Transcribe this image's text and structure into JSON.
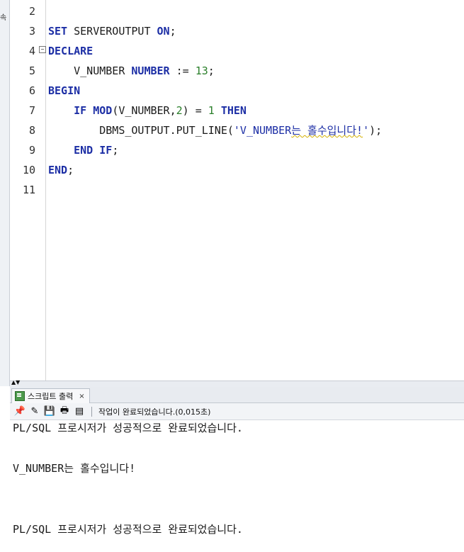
{
  "left_strip": {
    "label": "속"
  },
  "editor": {
    "line_numbers": [
      "2",
      "3",
      "4",
      "5",
      "6",
      "7",
      "8",
      "9",
      "10",
      "11"
    ],
    "lines": [
      {
        "tokens": []
      },
      {
        "tokens": [
          {
            "t": "SET",
            "c": "kw"
          },
          {
            "t": " SERVEROUTPUT ",
            "c": ""
          },
          {
            "t": "ON",
            "c": "kw"
          },
          {
            "t": ";",
            "c": ""
          }
        ]
      },
      {
        "tokens": [
          {
            "t": "DECLARE",
            "c": "kw"
          }
        ]
      },
      {
        "tokens": [
          {
            "t": "    V_NUMBER ",
            "c": ""
          },
          {
            "t": "NUMBER",
            "c": "kw"
          },
          {
            "t": " := ",
            "c": ""
          },
          {
            "t": "13",
            "c": "num"
          },
          {
            "t": ";",
            "c": ""
          }
        ]
      },
      {
        "tokens": [
          {
            "t": "BEGIN",
            "c": "kw"
          }
        ]
      },
      {
        "tokens": [
          {
            "t": "    ",
            "c": ""
          },
          {
            "t": "IF",
            "c": "kw"
          },
          {
            "t": " ",
            "c": ""
          },
          {
            "t": "MOD",
            "c": "kw"
          },
          {
            "t": "(V_NUMBER,",
            "c": ""
          },
          {
            "t": "2",
            "c": "num"
          },
          {
            "t": ") = ",
            "c": ""
          },
          {
            "t": "1",
            "c": "num"
          },
          {
            "t": " ",
            "c": ""
          },
          {
            "t": "THEN",
            "c": "kw"
          }
        ]
      },
      {
        "tokens": [
          {
            "t": "        DBMS_OUTPUT.PUT_LINE(",
            "c": ""
          },
          {
            "t": "'V_NUMBER",
            "c": "str"
          },
          {
            "t": "는 홀수입니다!",
            "c": "str squig"
          },
          {
            "t": "'",
            "c": "str"
          },
          {
            "t": ");",
            "c": ""
          }
        ]
      },
      {
        "tokens": [
          {
            "t": "    ",
            "c": ""
          },
          {
            "t": "END",
            "c": "kw"
          },
          {
            "t": " ",
            "c": ""
          },
          {
            "t": "IF",
            "c": "kw"
          },
          {
            "t": ";",
            "c": ""
          }
        ]
      },
      {
        "tokens": [
          {
            "t": "END",
            "c": "kw"
          },
          {
            "t": ";",
            "c": ""
          }
        ]
      },
      {
        "tokens": []
      }
    ],
    "fold_marker": "−"
  },
  "splitter": {
    "arrows": "▲▼"
  },
  "output_panel": {
    "tab_label": "스크립트 출력",
    "tab_close": "×",
    "toolbar_icons": [
      "pin-icon",
      "eraser-icon",
      "save-icon",
      "print-icon",
      "script-icon"
    ],
    "toolbar_glyphs": [
      "📌",
      "✎",
      "💾",
      "🖶",
      "▤"
    ],
    "status": "작업이 완료되었습니다.(0,015초)",
    "lines": [
      "PL/SQL 프로시저가 성공적으로 완료되었습니다.",
      "",
      "V_NUMBER는 홀수입니다!",
      "",
      "",
      "PL/SQL 프로시저가 성공적으로 완료되었습니다."
    ]
  },
  "colors": {
    "keyword": "#1c2ea5",
    "number": "#2a7f2a",
    "string": "#1c2ea5"
  }
}
